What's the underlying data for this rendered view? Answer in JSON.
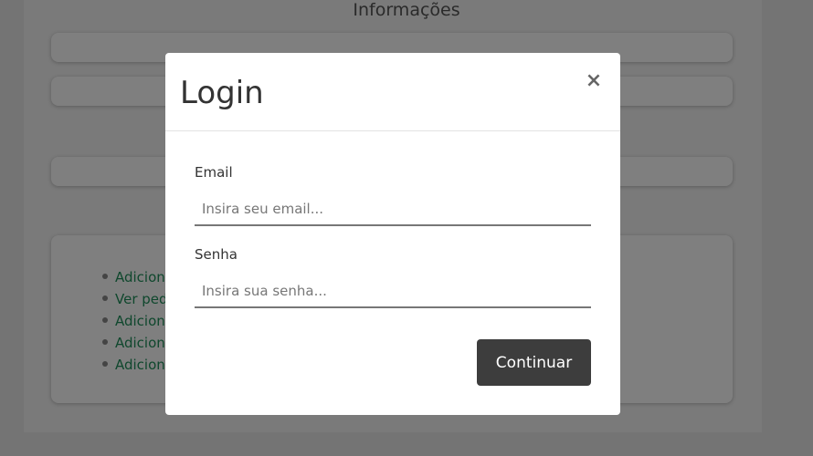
{
  "background": {
    "heading": "Informações",
    "links": [
      "Adicion",
      "Ver ped",
      "Adicion",
      "Adicion",
      "Adicion"
    ]
  },
  "modal": {
    "title": "Login",
    "close_label": "×",
    "email_label": "Email",
    "email_placeholder": "Insira seu email...",
    "email_value": "",
    "password_label": "Senha",
    "password_placeholder": "Insira sua senha...",
    "password_value": "",
    "submit_label": "Continuar"
  },
  "colors": {
    "overlay": "#000000",
    "button": "#3d3d3d",
    "link": "#1f8f5a"
  }
}
